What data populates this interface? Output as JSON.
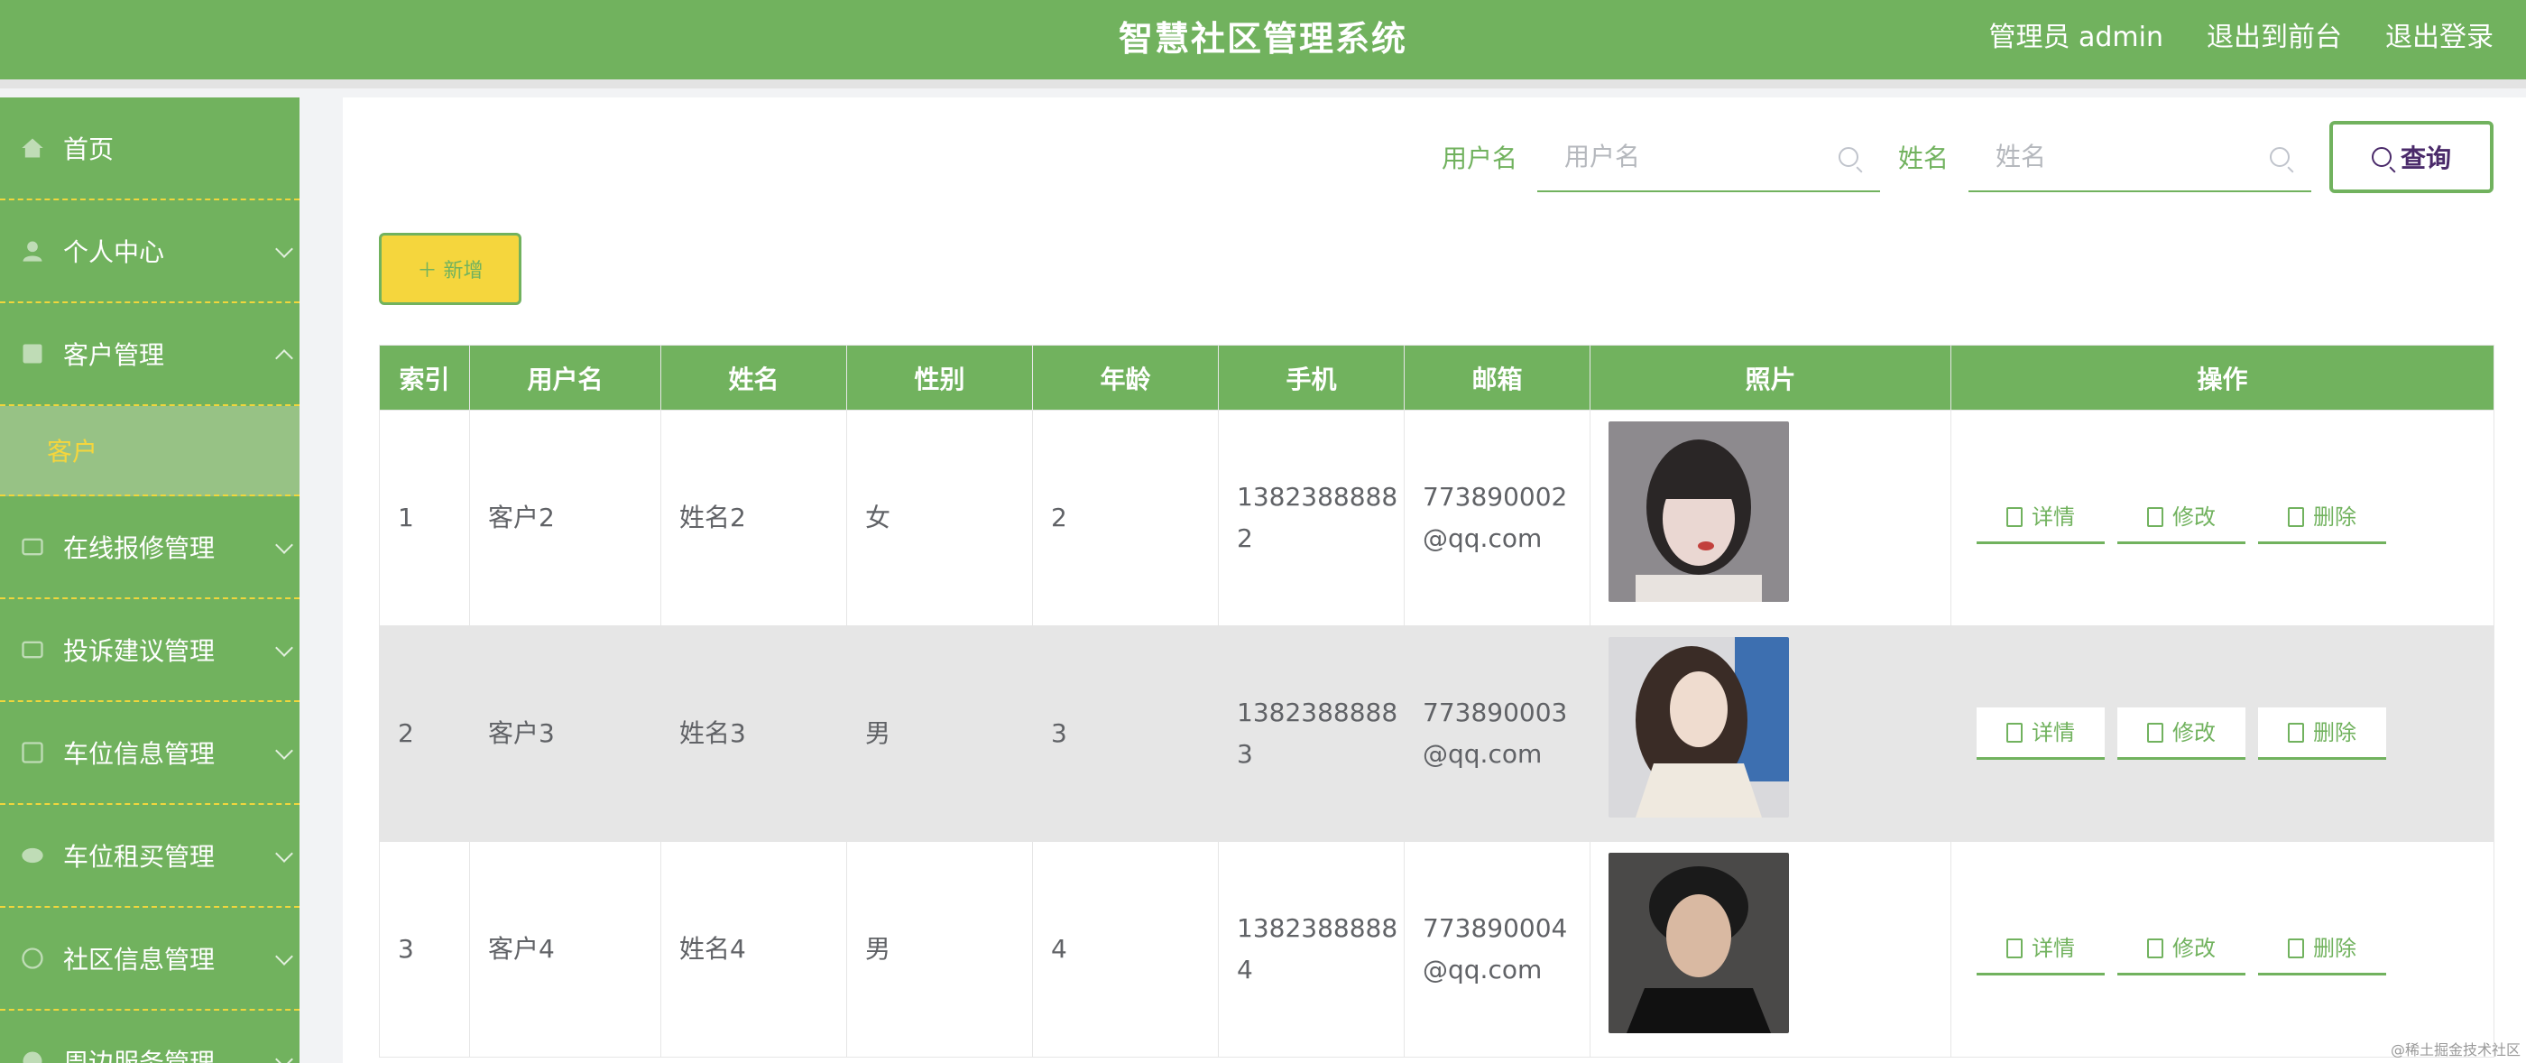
{
  "header": {
    "title": "智慧社区管理系统",
    "admin": "管理员 admin",
    "front": "退出到前台",
    "logout": "退出登录"
  },
  "sidebar": {
    "items": [
      {
        "label": "首页",
        "icon": "home-icon"
      },
      {
        "label": "个人中心",
        "icon": "user-icon"
      },
      {
        "label": "客户管理",
        "icon": "grid-icon"
      },
      {
        "label": "在线报修管理",
        "icon": "tool-icon"
      },
      {
        "label": "投诉建议管理",
        "icon": "message-icon"
      },
      {
        "label": "车位信息管理",
        "icon": "parking-icon"
      },
      {
        "label": "车位租买管理",
        "icon": "car-icon"
      },
      {
        "label": "社区信息管理",
        "icon": "community-icon"
      },
      {
        "label": "周边服务管理",
        "icon": "service-icon"
      }
    ],
    "submenu_label": "客户"
  },
  "search": {
    "username_label": "用户名",
    "username_placeholder": "用户名",
    "name_label": "姓名",
    "name_placeholder": "姓名",
    "query_label": "查询"
  },
  "toolbar": {
    "add_label": "＋ 新增"
  },
  "table": {
    "headers": [
      "索引",
      "用户名",
      "姓名",
      "性别",
      "年龄",
      "手机",
      "邮箱",
      "照片",
      "操作"
    ],
    "rows": [
      {
        "index": "1",
        "username": "客户2",
        "name": "姓名2",
        "gender": "女",
        "age": "2",
        "phone1": "1382388888",
        "phone2": "2",
        "email1": "773890002",
        "email2": "@qq.com"
      },
      {
        "index": "2",
        "username": "客户3",
        "name": "姓名3",
        "gender": "男",
        "age": "3",
        "phone1": "1382388888",
        "phone2": "3",
        "email1": "773890003",
        "email2": "@qq.com"
      },
      {
        "index": "3",
        "username": "客户4",
        "name": "姓名4",
        "gender": "男",
        "age": "4",
        "phone1": "1382388888",
        "phone2": "4",
        "email1": "773890004",
        "email2": "@qq.com"
      }
    ],
    "ops": {
      "detail": "详情",
      "edit": "修改",
      "delete": "删除"
    }
  },
  "colors": {
    "primary": "#71b25e",
    "accent": "#f5d63d",
    "query_text": "#4a2a6a"
  },
  "watermark": "@稀土掘金技术社区"
}
